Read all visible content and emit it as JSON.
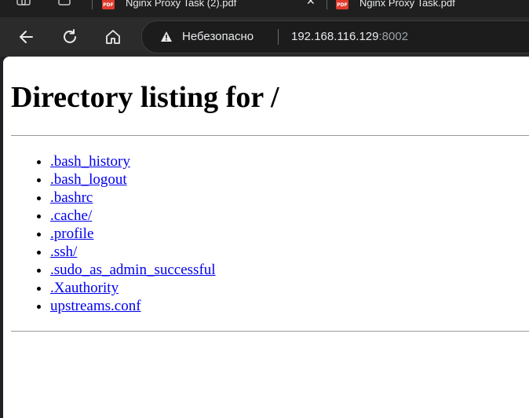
{
  "browser": {
    "tabs": [
      {
        "title": "Nginx Proxy Task (2).pdf",
        "icon": "pdf-icon"
      },
      {
        "title": "Nginx Proxy Task.pdf",
        "icon": "pdf-icon"
      }
    ],
    "tab_close_glyph": "✕",
    "address": {
      "security_label": "Небезопасно",
      "host": "192.168.116.129",
      "port": ":8002"
    },
    "buttons": {
      "back": "back-arrow-icon",
      "reload": "reload-icon",
      "home": "home-icon"
    }
  },
  "page": {
    "heading": "Directory listing for /",
    "entries": [
      ".bash_history",
      ".bash_logout",
      ".bashrc",
      ".cache/",
      ".profile",
      ".ssh/",
      ".sudo_as_admin_successful",
      ".Xauthority",
      "upstreams.conf"
    ]
  },
  "colors": {
    "link": "#0000ee",
    "pdf_icon": "#e23b2e",
    "chrome_dark": "#2b2b2b"
  }
}
